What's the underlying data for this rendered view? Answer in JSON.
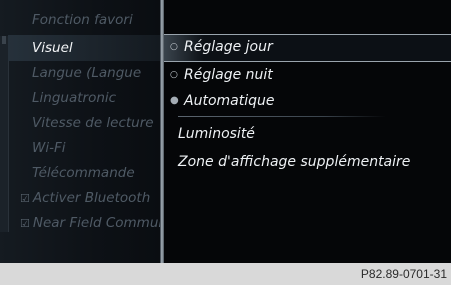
{
  "left_menu": {
    "items": [
      {
        "label": "Fonction favori",
        "selected": false,
        "checkbox": false
      },
      {
        "label": "Visuel",
        "selected": true,
        "checkbox": false
      },
      {
        "label": "Langue (Langue",
        "selected": false,
        "checkbox": false
      },
      {
        "label": "Linguatronic",
        "selected": false,
        "checkbox": false
      },
      {
        "label": "Vitesse de lecture",
        "selected": false,
        "checkbox": false
      },
      {
        "label": "Wi-Fi",
        "selected": false,
        "checkbox": false
      },
      {
        "label": "Télécommande",
        "selected": false,
        "checkbox": false
      },
      {
        "label": "Activer Bluetooth",
        "selected": false,
        "checkbox": true,
        "checkbox_icon": "checkbox-checked-icon",
        "checkbox_glyph": "☑"
      },
      {
        "label": "Near Field Communication",
        "selected": false,
        "checkbox": true,
        "checkbox_icon": "checkbox-checked-icon",
        "checkbox_glyph": "☑"
      }
    ]
  },
  "right_menu": {
    "items": [
      {
        "label": "Réglage jour",
        "marker": "radio-empty-icon",
        "glyph": "○",
        "selected": true
      },
      {
        "label": "Réglage nuit",
        "marker": "radio-empty-icon",
        "glyph": "○",
        "selected": false
      },
      {
        "label": "Automatique",
        "marker": "radio-filled-icon",
        "glyph": "●",
        "selected": false
      },
      {
        "label": "Luminosité",
        "marker": "",
        "glyph": "",
        "selected": false
      },
      {
        "label": "Zone d'affichage supplémentaire",
        "marker": "",
        "glyph": "",
        "selected": false
      }
    ]
  },
  "caption": "P82.89-0701-31",
  "colors": {
    "screen_bg": "#050608",
    "text_active": "#f2f4f6",
    "text_dim": "#4f5a65",
    "caption_bg": "#d9d9d9"
  }
}
